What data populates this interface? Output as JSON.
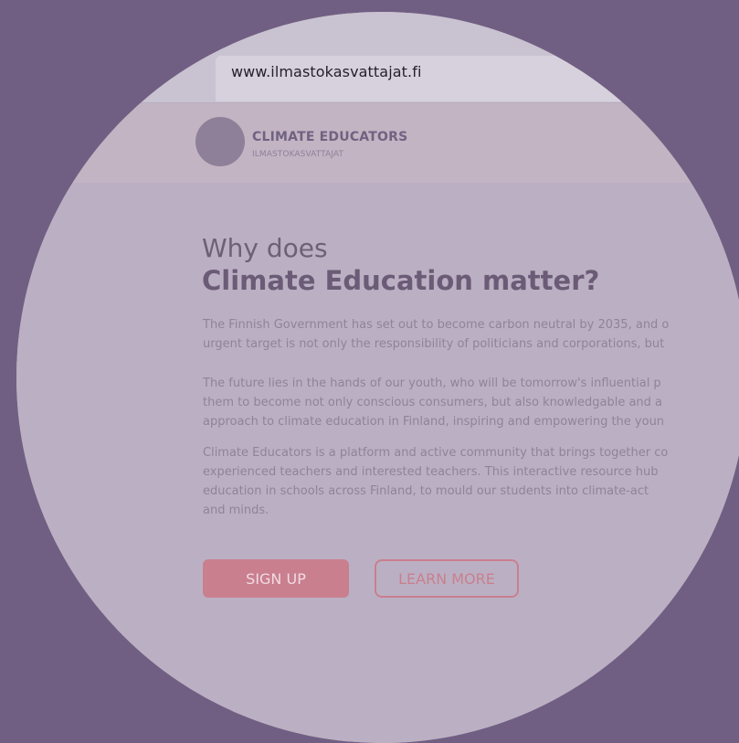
{
  "browser": {
    "url": "www.ilmastokasvattajat.fi"
  },
  "site": {
    "brand_name": "CLIMATE EDUCATORS",
    "brand_subtitle": "ILMASTOKASVATTAJAT"
  },
  "hero": {
    "heading_line1": "Why does",
    "heading_line2": "Climate Education matter?",
    "paragraph1": "The Finnish Government has set out to become carbon neutral by 2035, and o\nurgent target is not only the responsibility of politicians and corporations, but",
    "paragraph2": "The future lies in the hands of our youth, who will be tomorrow's influential p\nthem to become not only conscious consumers, but also knowledgable and a\napproach to climate education in Finland, inspiring and empowering the youn",
    "paragraph3": "Climate Educators is a platform and active community that brings together co\nexperienced teachers and interested teachers. This interactive resource hub\neducation in schools across Finland, to mould our students into climate-act\nand minds."
  },
  "buttons": {
    "sign_up": "SIGN UP",
    "learn_more": "LEARN MORE"
  },
  "colors": {
    "backdrop": "#715f83",
    "accent": "#c97f8e",
    "heading": "#6b5b76"
  }
}
